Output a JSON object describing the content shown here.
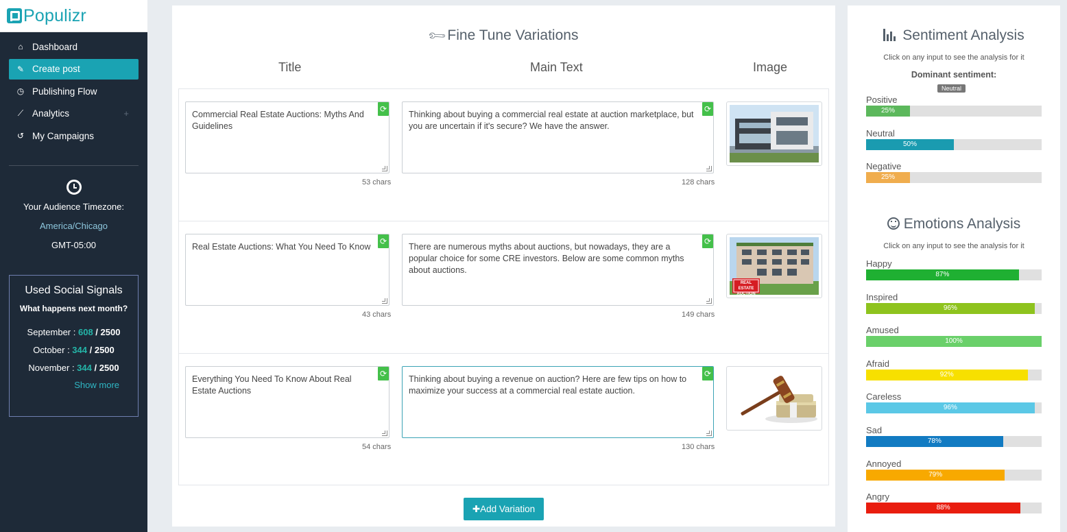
{
  "app": {
    "name": "Populizr"
  },
  "sidebar": {
    "items": [
      {
        "label": "Dashboard",
        "icon": "home-icon",
        "glyph": "⌂"
      },
      {
        "label": "Create post",
        "icon": "edit-icon",
        "glyph": "✎",
        "active": true
      },
      {
        "label": "Publishing Flow",
        "icon": "clock-icon",
        "glyph": "◷"
      },
      {
        "label": "Analytics",
        "icon": "chart-line-icon",
        "glyph": "⟋",
        "expand": "+"
      },
      {
        "label": "My Campaigns",
        "icon": "history-icon",
        "glyph": "↺"
      }
    ],
    "timezone": {
      "label": "Your Audience Timezone:",
      "city": "America/Chicago",
      "offset": "GMT-05:00"
    },
    "signals": {
      "title": "Used Social Signals",
      "subtitle": "What happens next month?",
      "rows": [
        {
          "month": "September : ",
          "used": "608",
          "total": " / 2500"
        },
        {
          "month": "October : ",
          "used": "344",
          "total": " / 2500"
        },
        {
          "month": "November : ",
          "used": "344",
          "total": " / 2500"
        }
      ],
      "show_more": "Show more"
    }
  },
  "main": {
    "title": "Fine Tune Variations",
    "columns": {
      "title": "Title",
      "main_text": "Main Text",
      "image": "Image"
    },
    "variations": [
      {
        "title": "Commercial Real Estate Auctions: Myths And Guidelines",
        "title_chars": "53 chars",
        "text": "Thinking about buying a commercial real estate at auction marketplace, but you are uncertain if it's secure? We have the answer.",
        "text_chars": "128 chars",
        "image": "modern-house-image"
      },
      {
        "title": "Real Estate Auctions: What You Need To Know",
        "title_chars": "43 chars",
        "text": "There are numerous myths about auctions, but nowadays, they are a popular choice for some CRE investors. Below are some common myths about auctions.",
        "text_chars": "149 chars",
        "image": "auction-building-image",
        "image_sign": "REAL ESTATE AUCTION"
      },
      {
        "title": "Everything You Need To Know About Real Estate Auctions",
        "title_chars": "54 chars",
        "text": "Thinking about buying a revenue on auction? Here are few tips on how to maximize your success at a commercial real estate auction.",
        "text_chars": "130 chars",
        "image": "gavel-money-image"
      }
    ],
    "add_button": "Add Variation"
  },
  "sentiment": {
    "title": "Sentiment Analysis",
    "subtitle": "Click on any input to see the analysis for it",
    "dominant_label": "Dominant sentiment:",
    "dominant_value": "Neutral",
    "bars": [
      {
        "label": "Positive",
        "value": 25,
        "text": "25%",
        "color": "#5cb85c"
      },
      {
        "label": "Neutral",
        "value": 50,
        "text": "50%",
        "color": "#1a9bb0"
      },
      {
        "label": "Negative",
        "value": 25,
        "text": "25%",
        "color": "#f0ad4e"
      }
    ]
  },
  "emotions": {
    "title": "Emotions Analysis",
    "subtitle": "Click on any input to see the analysis for it",
    "bars": [
      {
        "label": "Happy",
        "value": 87,
        "text": "87%",
        "color": "#1fb032"
      },
      {
        "label": "Inspired",
        "value": 96,
        "text": "96%",
        "color": "#8ec31e"
      },
      {
        "label": "Amused",
        "value": 100,
        "text": "100%",
        "color": "#6ad06a"
      },
      {
        "label": "Afraid",
        "value": 92,
        "text": "92%",
        "color": "#f7e000"
      },
      {
        "label": "Careless",
        "value": 96,
        "text": "96%",
        "color": "#5bc8e6"
      },
      {
        "label": "Sad",
        "value": 78,
        "text": "78%",
        "color": "#127bc2"
      },
      {
        "label": "Annoyed",
        "value": 79,
        "text": "79%",
        "color": "#f8a900"
      },
      {
        "label": "Angry",
        "value": 88,
        "text": "88%",
        "color": "#e91d0f"
      }
    ]
  }
}
